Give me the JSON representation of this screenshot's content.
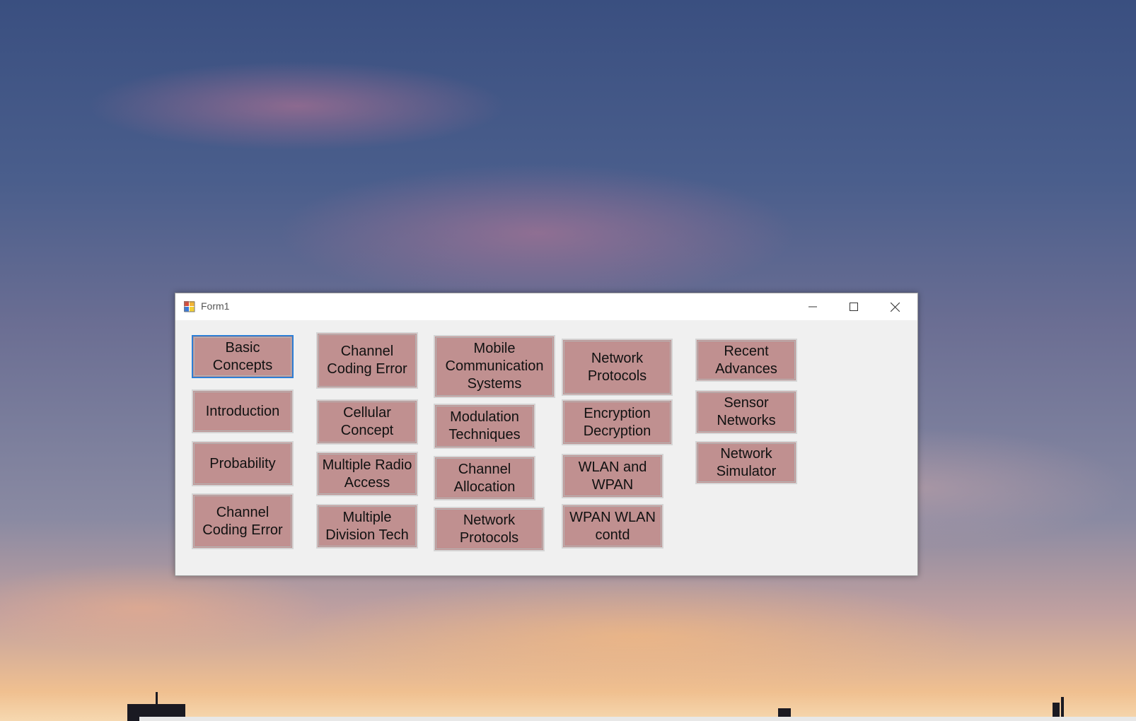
{
  "window": {
    "title": "Form1"
  },
  "buttons": {
    "col1": [
      "Basic Concepts",
      "Introduction",
      "Probability",
      "Channel Coding Error"
    ],
    "col2": [
      "Channel Coding Error",
      "Cellular Concept",
      "Multiple Radio Access",
      "Multiple Division Tech"
    ],
    "col3": [
      "Mobile Communication Systems",
      "Modulation Techniques",
      "Channel Allocation",
      "Network Protocols"
    ],
    "col4": [
      "Network Protocols",
      "Encryption Decryption",
      "WLAN and WPAN",
      "WPAN WLAN contd"
    ],
    "col5": [
      "Recent Advances",
      "Sensor Networks",
      "Network Simulator"
    ]
  },
  "colors": {
    "button_face": "#c09090",
    "focus_border": "#2c7fd6",
    "window_bg": "#f0f0f0"
  },
  "icons": {
    "app": "form-app-icon",
    "minimize": "minimize-icon",
    "maximize": "maximize-icon",
    "close": "close-icon"
  }
}
